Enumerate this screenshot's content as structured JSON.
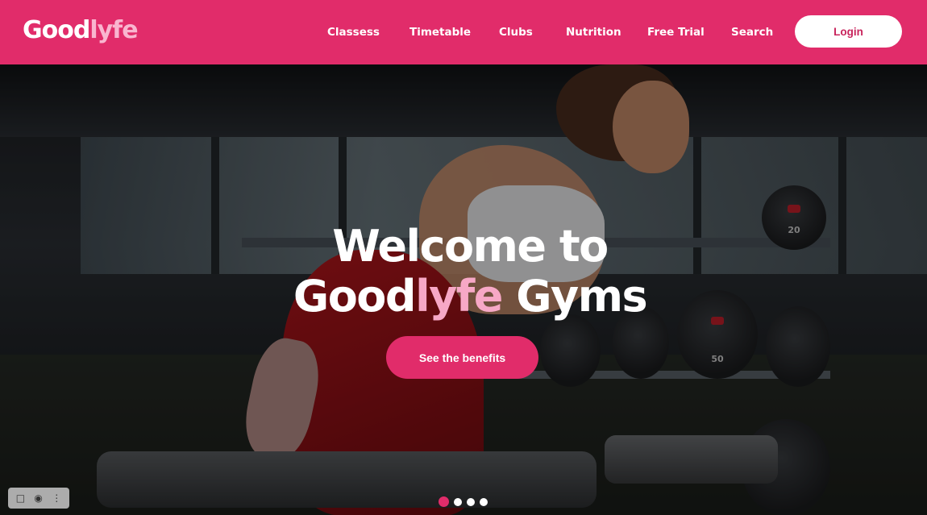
{
  "header": {
    "logo": {
      "primary": "Good",
      "accent": "lyfe"
    },
    "nav": [
      "Classess",
      "Timetable",
      "Clubs",
      "Nutrition",
      "Free Trial",
      "Search"
    ],
    "login_label": "Login",
    "colors": {
      "brand": "#e12c6a",
      "accent": "#f9b5cf"
    }
  },
  "hero": {
    "title_line1": "Welcome to",
    "title_line2_primary": "Good",
    "title_line2_accent": "lyfe",
    "title_line2_rest": " Gyms",
    "cta_label": "See the benefits",
    "dumbbell_labels": [
      "20",
      "50"
    ],
    "slides": {
      "count": 4,
      "active": 1
    }
  },
  "toolbar": {
    "icons": [
      "bookmark-icon",
      "camera-icon",
      "more-icon"
    ]
  }
}
